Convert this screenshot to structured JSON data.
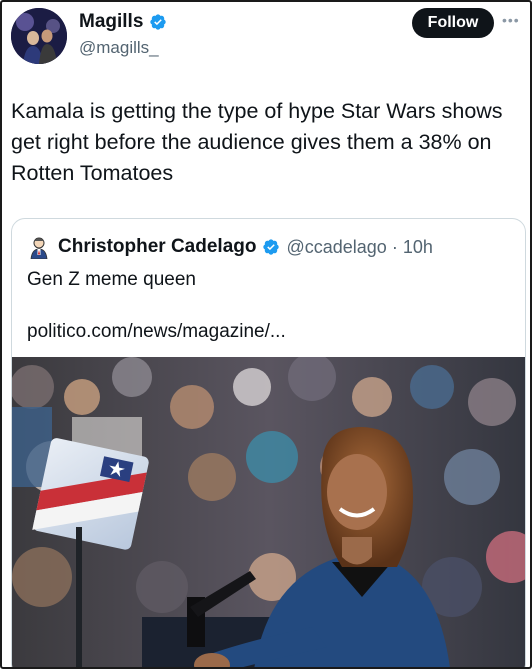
{
  "author": {
    "display_name": "Magills",
    "handle": "@magills_",
    "verified": true,
    "follow_label": "Follow",
    "more_icon": "more-dots-icon"
  },
  "tweet": {
    "text": "Kamala is getting the type of hype Star Wars shows get right before the audience gives them a 38% on Rotten Tomatoes"
  },
  "quoted": {
    "display_name": "Christopher Cadelago",
    "handle_time": "@ccadelago · 10h",
    "verified": true,
    "text": "Gen Z meme queen",
    "link": "politico.com/news/magazine/..."
  },
  "colors": {
    "verified_blue": "#1d9bf0",
    "follow_bg": "#0f1419",
    "handle_gray": "#536471"
  }
}
